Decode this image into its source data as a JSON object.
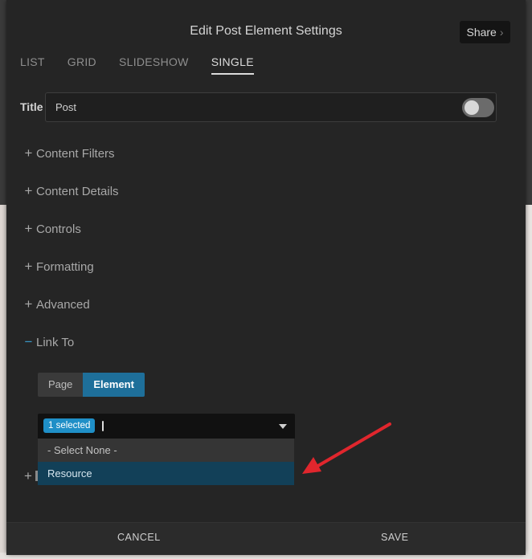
{
  "modal": {
    "title": "Edit Post Element Settings",
    "share_label": "Share",
    "share_icon": "chevron-right-icon"
  },
  "tabs": [
    {
      "label": "LIST",
      "active": false
    },
    {
      "label": "GRID",
      "active": false
    },
    {
      "label": "SLIDESHOW",
      "active": false
    },
    {
      "label": "SINGLE",
      "active": true
    }
  ],
  "title_field": {
    "label": "Title",
    "value": "Post",
    "toggle_on": false
  },
  "sections": [
    {
      "label": "Content Filters",
      "sign": "+"
    },
    {
      "label": "Content Details",
      "sign": "+"
    },
    {
      "label": "Controls",
      "sign": "+"
    },
    {
      "label": "Formatting",
      "sign": "+"
    },
    {
      "label": "Advanced",
      "sign": "+"
    },
    {
      "label": "Link To",
      "sign": "−"
    }
  ],
  "link_to": {
    "options": [
      "Page",
      "Element"
    ],
    "selected": "Element",
    "select": {
      "badge": "1 selected",
      "dropdown_items": [
        "- Select None -",
        "Resource"
      ],
      "highlighted": "Resource"
    }
  },
  "footer": {
    "cancel_label": "CANCEL",
    "save_label": "SAVE"
  },
  "colors": {
    "accent": "#1f8fc7",
    "selected_segment": "#1e6f9a",
    "annotation_arrow": "#e0262d"
  }
}
